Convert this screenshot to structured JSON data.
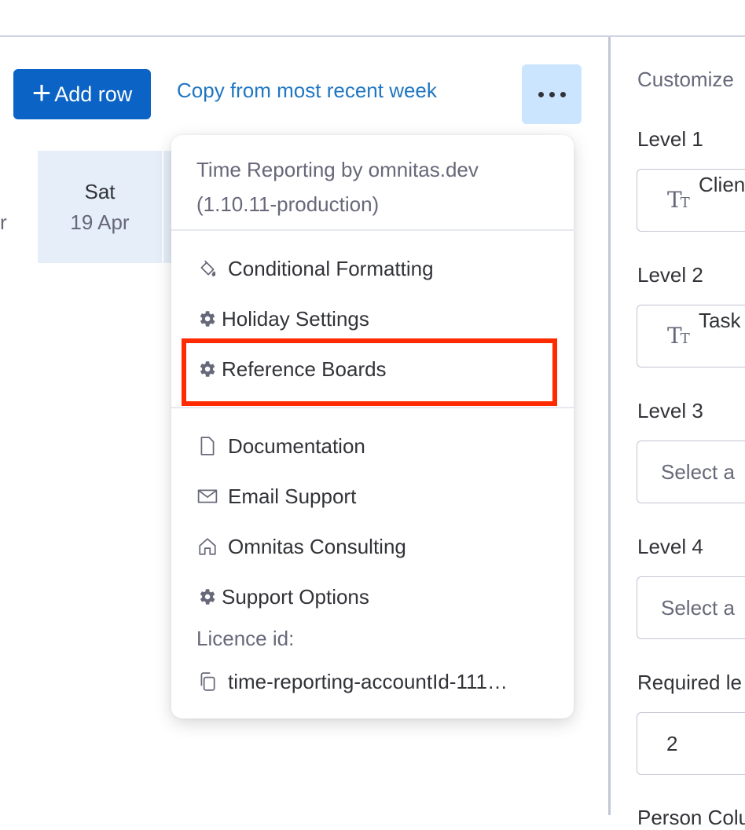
{
  "toolbar": {
    "add_row_label": "Add row",
    "copy_link": "Copy from most recent week"
  },
  "grid": {
    "partial_day_suffix": "r",
    "sat_day": "Sat",
    "sat_date": "19 Apr"
  },
  "menu": {
    "header_line1": "Time Reporting by omnitas.dev",
    "header_line2": "(1.10.11-production)",
    "items": [
      {
        "label": "Conditional Formatting",
        "icon": "paint-bucket-icon"
      },
      {
        "label": "Holiday Settings",
        "icon": "gear-icon"
      },
      {
        "label": "Reference Boards",
        "icon": "gear-icon"
      },
      {
        "label": "Documentation",
        "icon": "document-icon"
      },
      {
        "label": "Email Support",
        "icon": "envelope-icon"
      },
      {
        "label": "Omnitas Consulting",
        "icon": "home-icon"
      },
      {
        "label": "Support Options",
        "icon": "gear-icon"
      }
    ],
    "licence_label": "Licence id:",
    "licence_value": "time-reporting-accountId-111…",
    "highlight_color": "#ff2a00"
  },
  "settings": {
    "title": "Customize",
    "level1_label": "Level 1",
    "level1_value": "Clien",
    "level2_label": "Level 2",
    "level2_value": "Task",
    "level3_label": "Level 3",
    "level3_placeholder": "Select a",
    "level4_label": "Level 4",
    "level4_placeholder": "Select a",
    "required_label": "Required le",
    "required_value": "2",
    "person_label": "Person Colu"
  },
  "colors": {
    "primary": "#0b63c5",
    "link": "#1f76c2",
    "more_bg": "#cce5ff",
    "day_bg": "#e5eef9"
  }
}
